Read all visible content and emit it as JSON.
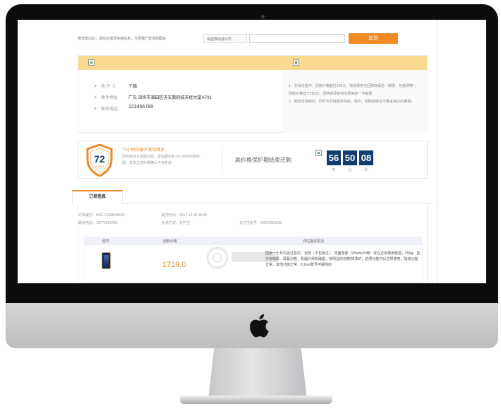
{
  "logistics": {
    "instruction": "物流发出后，请在此填写快递信息，方便我们查询和跟进",
    "company_select": "请选择快递公司",
    "tracking_placeholder": "",
    "submit_label": "发货"
  },
  "address": {
    "rows": [
      {
        "key": "收 件 人",
        "value": "千猫"
      },
      {
        "key": "收件地址",
        "value": "广东 深圳市福田区天安数码城天经大厦A701"
      },
      {
        "key": "联系电话",
        "value": "123456789"
      }
    ],
    "notes": [
      "1、交易过程中，回收价格超过100元，物流费用当回购商承担（邮费，包装费等）；回收价格低于100元，回购商承担物流费用的一半邮费",
      "2、物流支持到付，同时也支持顺丰快递，另外，回购商建议不要采用EMS邮寄。"
    ]
  },
  "guarantee": {
    "badge_number": "72",
    "badge_word": "HOURS",
    "title": "72小时价格不变动保护",
    "description": "您的物流订单提交后，评估报价有72小时内的保护期，发货之前价格确认不会变动",
    "middle_text": "高价格保护期结束还剩",
    "timer": {
      "hours": "56",
      "minutes": "50",
      "seconds": "08",
      "hours_label": "时",
      "minutes_label": "分",
      "seconds_label": "秒"
    }
  },
  "tabs": {
    "active_label": "订单信息"
  },
  "order": {
    "order_no": "订单编号：HG171228648642",
    "order_time": "提交时间：2017-12-28 18:45",
    "phone": "联系电话：18772863493",
    "pay_method": "交易方式：支付宝",
    "pay_account": "支付宝账号：ASDASDASD",
    "columns": [
      "型号",
      "回购价格",
      "评估描述情况"
    ],
    "item": {
      "price": "1719.0",
      "description": "国家一个月内拆过机的：全网（不包含过）、背面局部（iPhone外壳）存在正常使用痕迹，256g、显示有暗斑、屏幕划痕、机器外观有磕碰，有明显的划痕/掉漆的，拍照功能可以正常使用，指纹功能正常，其他功能正常，iCloud账号可解除的"
    }
  },
  "colors": {
    "accent": "#f08a24",
    "card_header": "#fbd98e",
    "timer_bg": "#123d72"
  }
}
